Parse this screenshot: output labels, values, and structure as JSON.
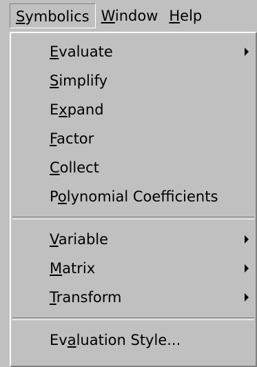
{
  "menubar": {
    "items": [
      {
        "pre": "",
        "key": "S",
        "post": "ymbolics"
      },
      {
        "pre": "",
        "key": "W",
        "post": "indow"
      },
      {
        "pre": "",
        "key": "H",
        "post": "elp"
      }
    ]
  },
  "menu": {
    "groups": [
      [
        {
          "pre": "",
          "key": "E",
          "post": "valuate",
          "submenu": true
        },
        {
          "pre": "",
          "key": "S",
          "post": "implify",
          "submenu": false
        },
        {
          "pre": "E",
          "key": "x",
          "post": "pand",
          "submenu": false
        },
        {
          "pre": "",
          "key": "F",
          "post": "actor",
          "submenu": false
        },
        {
          "pre": "",
          "key": "C",
          "post": "ollect",
          "submenu": false
        },
        {
          "pre": "P",
          "key": "o",
          "post": "lynomial Coefficients",
          "submenu": false
        }
      ],
      [
        {
          "pre": "",
          "key": "V",
          "post": "ariable",
          "submenu": true
        },
        {
          "pre": "",
          "key": "M",
          "post": "atrix",
          "submenu": true
        },
        {
          "pre": "",
          "key": "T",
          "post": "ransform",
          "submenu": true
        }
      ],
      [
        {
          "pre": "Ev",
          "key": "a",
          "post": "luation Style...",
          "submenu": false
        }
      ]
    ]
  }
}
